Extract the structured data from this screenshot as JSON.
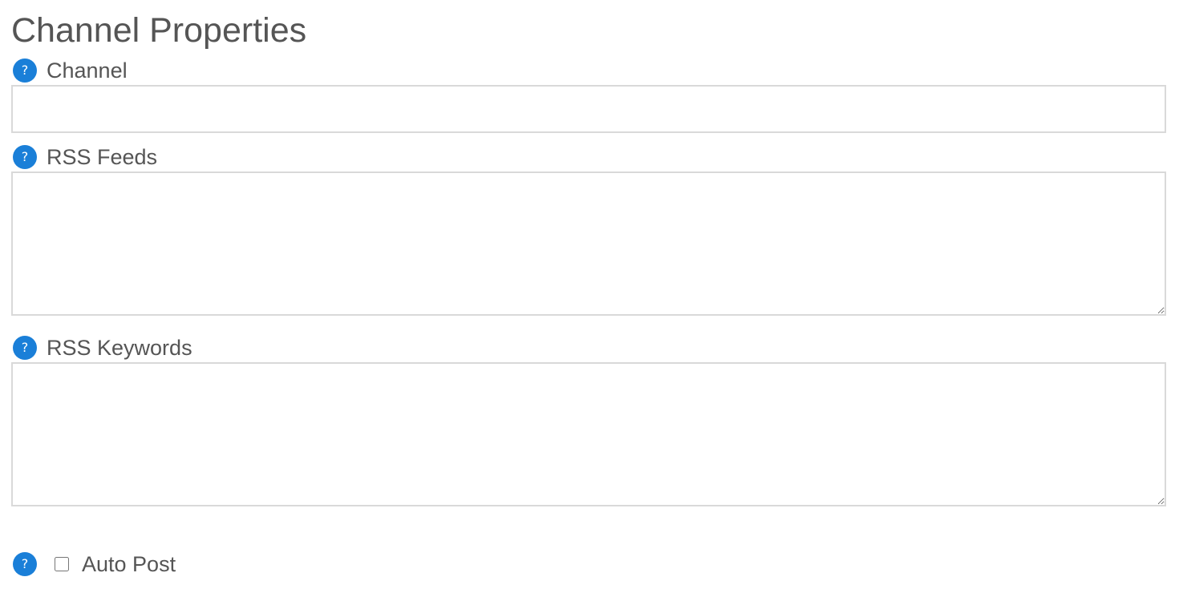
{
  "page_title": "Channel Properties",
  "help_icon_glyph": "?",
  "help_icon_name": "question-circle-icon",
  "accent_color": "#1a7fd8",
  "fields": {
    "channel": {
      "label": "Channel",
      "value": ""
    },
    "rss_feeds": {
      "label": "RSS Feeds",
      "value": ""
    },
    "rss_keywords": {
      "label": "RSS Keywords",
      "value": ""
    }
  },
  "auto_post": {
    "label": "Auto Post",
    "checked": false
  }
}
